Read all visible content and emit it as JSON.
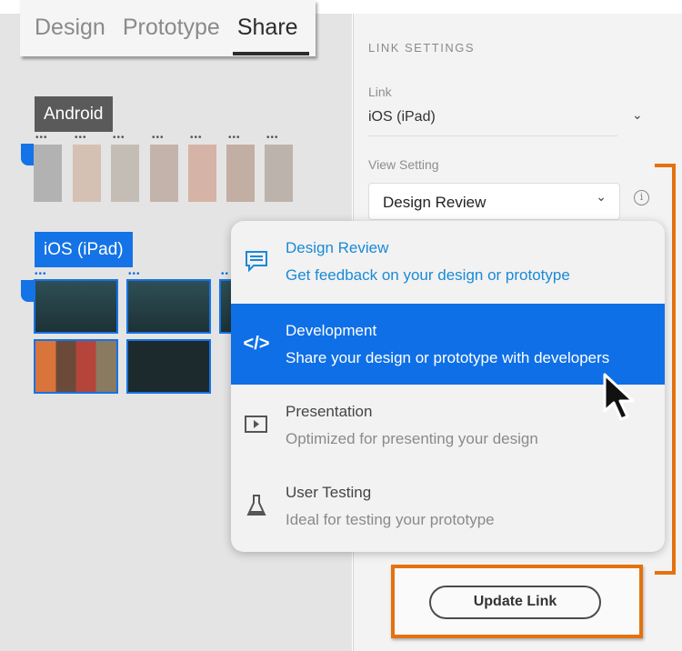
{
  "tabs": [
    {
      "label": "Design"
    },
    {
      "label": "Prototype"
    },
    {
      "label": "Share"
    }
  ],
  "canvas": {
    "android_label": "Android",
    "ipad_label": "iOS (iPad)"
  },
  "panel": {
    "section_title": "LINK SETTINGS",
    "link_label": "Link",
    "link_value": "iOS (iPad)",
    "view_label": "View Setting",
    "view_value": "Design Review",
    "update_button": "Update Link"
  },
  "menu": [
    {
      "title": "Design Review",
      "desc": "Get feedback on your design or prototype",
      "icon": "comment-icon"
    },
    {
      "title": "Development",
      "desc": "Share your design or prototype with developers",
      "icon": "code-icon"
    },
    {
      "title": "Presentation",
      "desc": "Optimized for presenting your design",
      "icon": "play-icon"
    },
    {
      "title": "User Testing",
      "desc": "Ideal for testing your prototype",
      "icon": "flask-icon"
    }
  ],
  "colors": {
    "accent": "#0f6fe6",
    "highlight": "#e4720f"
  }
}
